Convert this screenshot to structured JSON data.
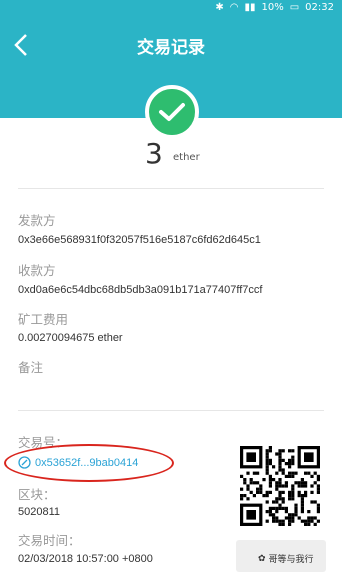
{
  "status_bar": {
    "battery": "10%",
    "time": "02:32"
  },
  "header": {
    "title": "交易记录"
  },
  "amount": {
    "value": "3",
    "unit": "ether"
  },
  "fields": {
    "sender_label": "发款方",
    "sender_value": "0x3e66e568931f0f32057f516e5187c6fd62d645c1",
    "receiver_label": "收款方",
    "receiver_value": "0xd0a6e6c54dbc68db5db3a091b171a77407ff7ccf",
    "fee_label": "矿工费用",
    "fee_value": "0.00270094675 ether",
    "note_label": "备注",
    "tx_label": "交易号：",
    "tx_value": "0x53652f...9bab0414",
    "block_label": "区块：",
    "block_value": "5020811",
    "time_label": "交易时间：",
    "time_value": "02/03/2018 10:57:00 +0800"
  },
  "watermark": "哥等与我行",
  "colors": {
    "header_bg": "#2bb4c6",
    "success": "#2ebd6f",
    "link": "#2ba3d6",
    "annotation": "#d9251d"
  }
}
